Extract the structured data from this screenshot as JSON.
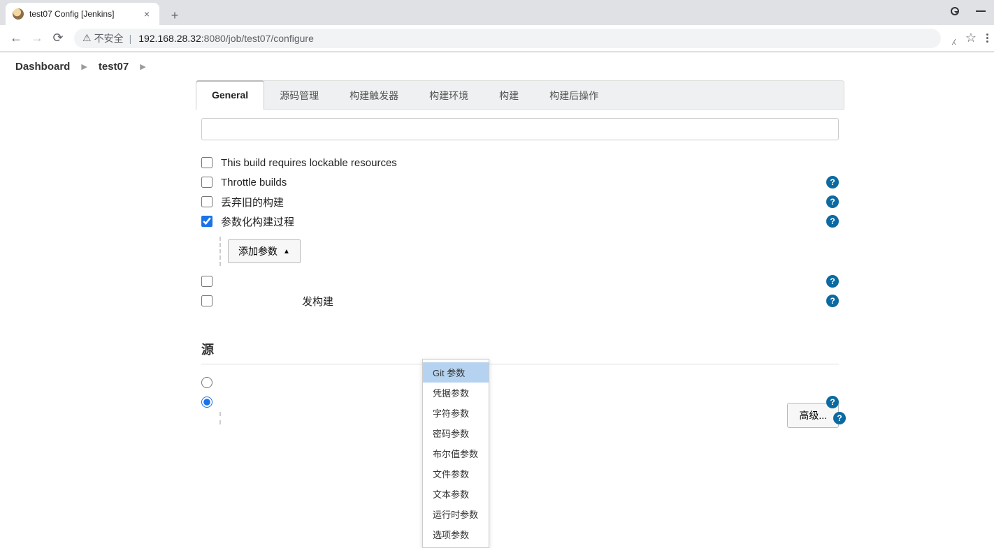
{
  "browser": {
    "tab_title": "test07 Config [Jenkins]",
    "insecure_label": "不安全",
    "url_host": "192.168.28.32",
    "url_port": ":8080",
    "url_path": "/job/test07/configure"
  },
  "breadcrumbs": {
    "items": [
      "Dashboard",
      "test07"
    ]
  },
  "config_tabs": [
    "General",
    "源码管理",
    "构建触发器",
    "构建环境",
    "构建",
    "构建后操作"
  ],
  "options": {
    "lockable": "This build requires lockable resources",
    "throttle": "Throttle builds",
    "discard": "丢弃旧的构建",
    "parameterized": "参数化构建过程",
    "concurrent_suffix": "发构建",
    "add_param_label": "添加参数"
  },
  "param_menu": [
    "Git 参数",
    "凭据参数",
    "字符参数",
    "密码参数",
    "布尔值参数",
    "文件参数",
    "文本参数",
    "运行时参数",
    "选项参数"
  ],
  "buttons": {
    "advanced": "高级..."
  },
  "section": {
    "src_partial": "源"
  }
}
